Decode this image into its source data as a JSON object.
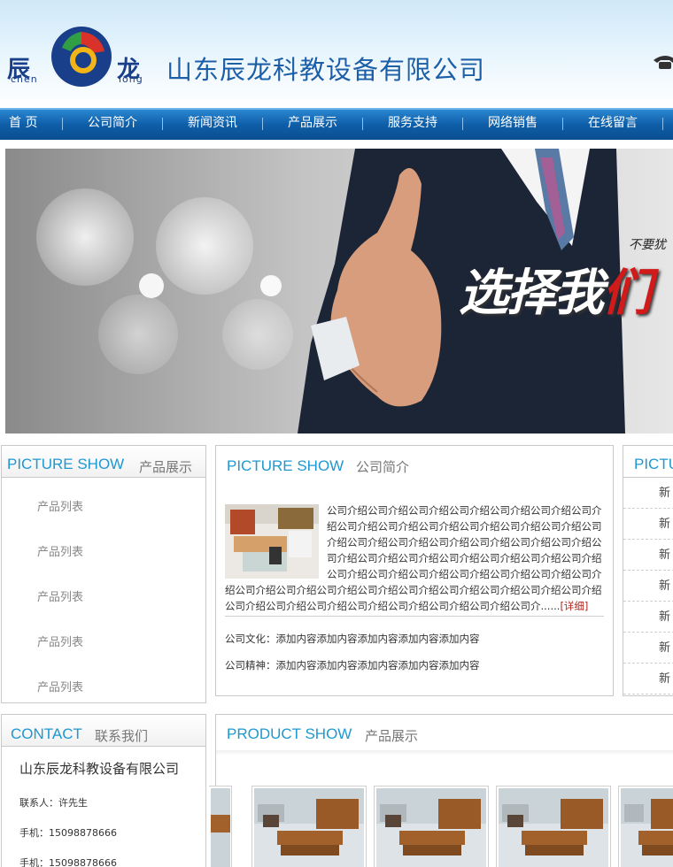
{
  "header": {
    "logo_cn_left": "辰",
    "logo_cn_right": "龙",
    "logo_en_left": "chen",
    "logo_en_right": "long",
    "company_name": "山东辰龙科教设备有限公司"
  },
  "nav": {
    "items": [
      "首 页",
      "公司简介",
      "新闻资讯",
      "产品展示",
      "服务支持",
      "网络销售",
      "在线留言"
    ]
  },
  "banner": {
    "small_text": "不要犹",
    "big_text_white": "选择我",
    "big_text_red": "们"
  },
  "products_panel": {
    "title_en": "PICTURE SHOW",
    "title_cn": "产品展示",
    "items": [
      "产品列表",
      "产品列表",
      "产品列表",
      "产品列表",
      "产品列表"
    ]
  },
  "about_panel": {
    "title_en": "PICTURE SHOW",
    "title_cn": "公司简介",
    "intro": "公司介绍公司介绍公司介绍公司介绍公司介绍公司介绍公司介绍公司介绍公司介绍公司介绍公司介绍公司介绍公司介绍公司介绍公司介绍公司介绍公司介绍公司介绍公司介绍公司介绍公司介绍公司介绍公司介绍公司介绍公司介绍公司介绍公司介绍公司介绍公司介绍公司介绍公司介绍公司介绍公司介绍公司介绍公司介绍公司介绍公司介绍公司介绍公司介绍公司介绍公司介绍公司介绍公司介绍公司介绍公司介绍公司介绍公司介绍公司介绍公司介绍公司介绍公司介......",
    "more": "[详细]",
    "culture": "公司文化：添加内容添加内容添加内容添加内容添加内容",
    "spirit": "公司精神：添加内容添加内容添加内容添加内容添加内容"
  },
  "news_panel": {
    "title_en": "PICTU",
    "items": [
      "新",
      "新",
      "新",
      "新",
      "新",
      "新",
      "新"
    ]
  },
  "contact_panel": {
    "title_en": "CONTACT",
    "title_cn": "联系我们",
    "company": "山东辰龙科教设备有限公司",
    "contact_person": "联系人：许先生",
    "mobile_1": "手机：15098878666",
    "mobile_2": "手机：15098878666"
  },
  "product_show_panel": {
    "title_en": "PRODUCT SHOW",
    "title_cn": "产品展示"
  },
  "colors": {
    "nav_blue": "#0f5ea8",
    "title_cyan": "#1e98d1",
    "company_blue": "#1b5fa8",
    "more_red": "#b3281f"
  }
}
